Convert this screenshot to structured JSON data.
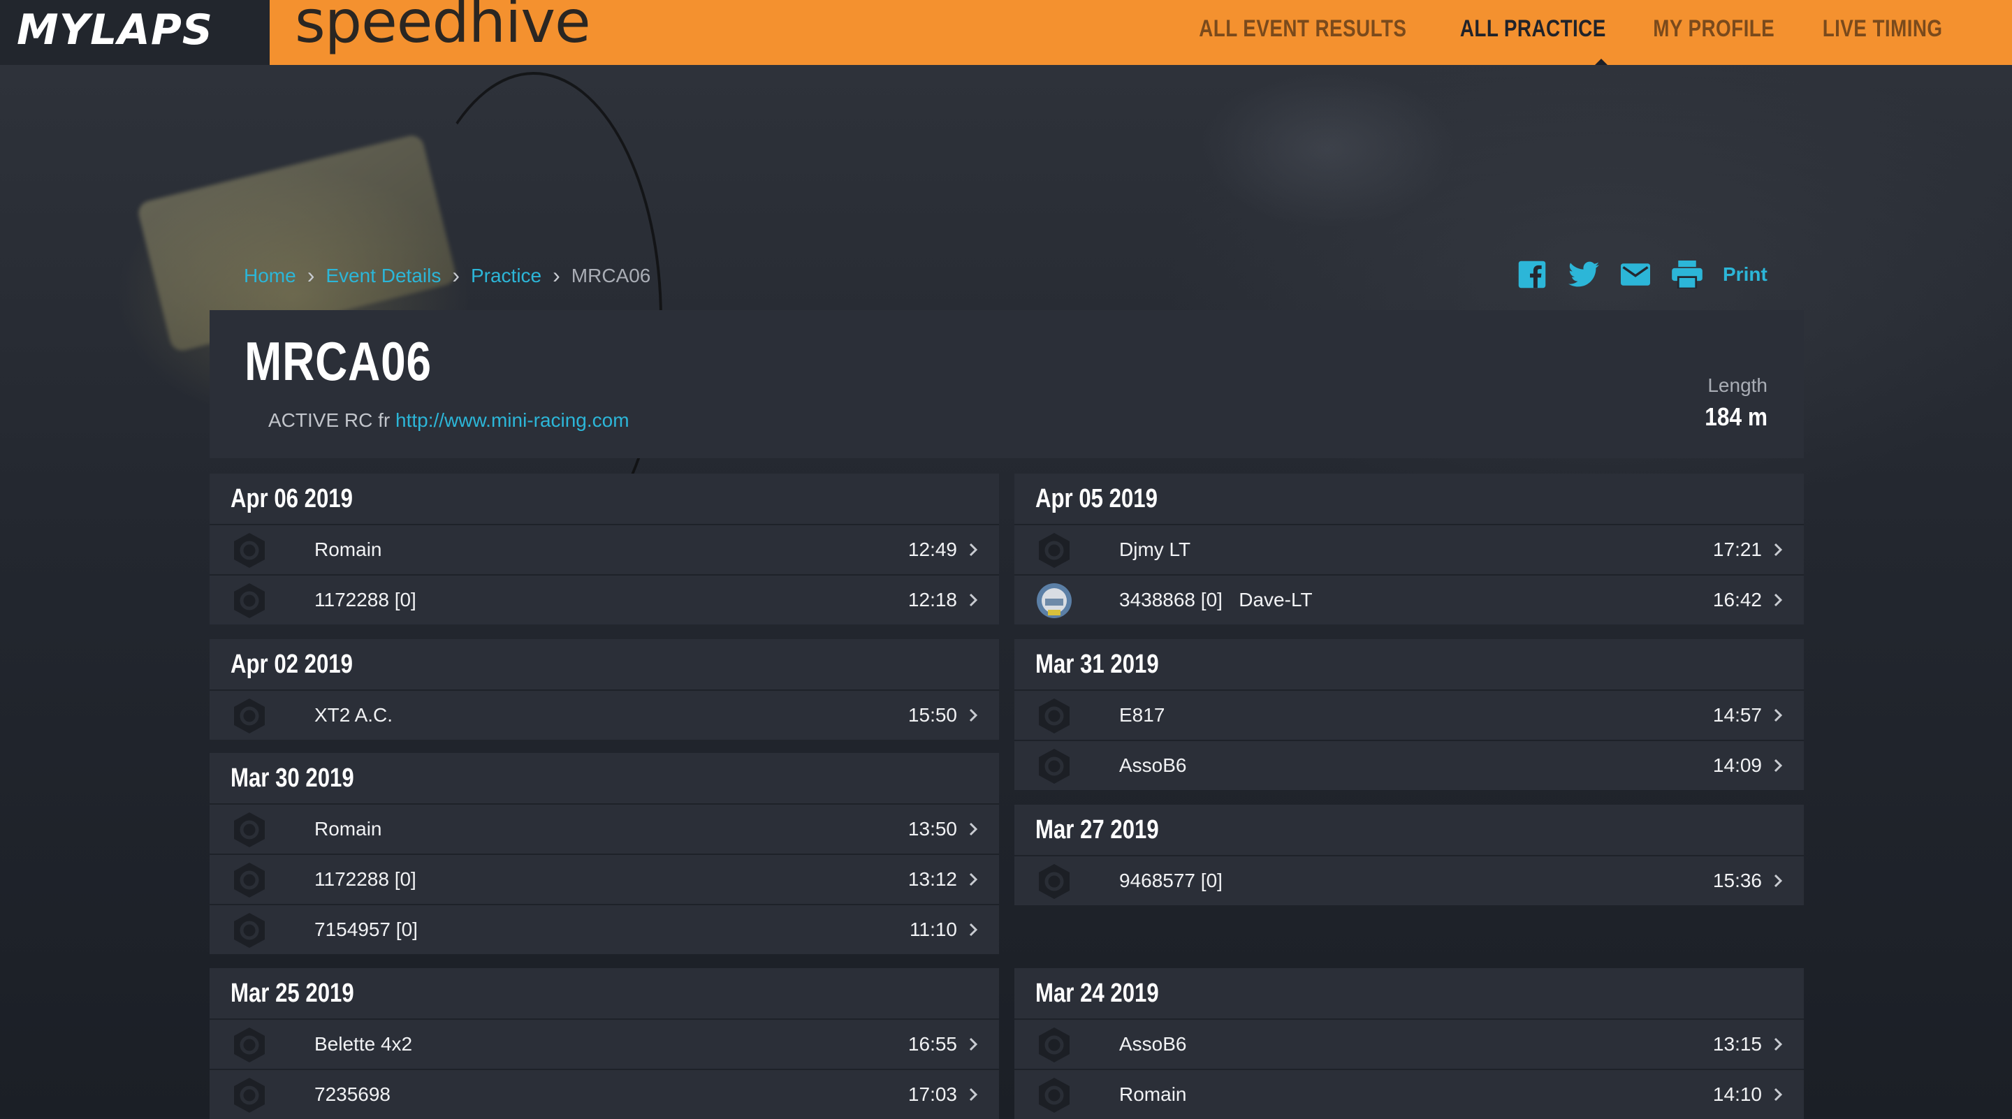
{
  "brand": {
    "mylaps": "MYLAPS",
    "speedhive": "speedhive"
  },
  "nav": [
    {
      "label": "ALL EVENT RESULTS",
      "active": false
    },
    {
      "label": "ALL PRACTICE",
      "active": true
    },
    {
      "label": "MY PROFILE",
      "active": false
    },
    {
      "label": "LIVE TIMING",
      "active": false
    }
  ],
  "breadcrumb": {
    "home": "Home",
    "event": "Event Details",
    "practice": "Practice",
    "current": "MRCA06"
  },
  "share": {
    "print": "Print"
  },
  "track": {
    "name": "MRCA06",
    "club": "ACTIVE RC fr",
    "url": "http://www.mini-racing.com",
    "length_label": "Length",
    "length_value": "184 m"
  },
  "days": [
    {
      "date": "Apr 06 2019",
      "rows": [
        {
          "name": "Romain",
          "time": "12:49"
        },
        {
          "name": "1172288 [0]",
          "time": "12:18"
        }
      ]
    },
    {
      "date": "Apr 05 2019",
      "rows": [
        {
          "name": "Djmy LT",
          "time": "17:21"
        },
        {
          "name": "3438868 [0]   Dave-LT",
          "time": "16:42",
          "avatar": "photo"
        }
      ]
    },
    {
      "date": "Apr 02 2019",
      "rows": [
        {
          "name": "XT2 A.C.",
          "time": "15:50"
        }
      ]
    },
    {
      "date": "Mar 31 2019",
      "rows": [
        {
          "name": "E817",
          "time": "14:57"
        },
        {
          "name": "AssoB6",
          "time": "14:09"
        }
      ]
    },
    {
      "date": "Mar 30 2019",
      "rows": [
        {
          "name": "Romain",
          "time": "13:50"
        },
        {
          "name": "1172288 [0]",
          "time": "13:12"
        },
        {
          "name": "7154957 [0]",
          "time": "11:10"
        }
      ]
    },
    {
      "date": "Mar 27 2019",
      "rows": [
        {
          "name": "9468577 [0]",
          "time": "15:36"
        }
      ]
    },
    {
      "date": "Mar 25 2019",
      "rows": [
        {
          "name": "Belette 4x2",
          "time": "16:55"
        },
        {
          "name": "7235698",
          "time": "17:03"
        }
      ]
    },
    {
      "date": "Mar 24 2019",
      "rows": [
        {
          "name": "AssoB6",
          "time": "13:15"
        },
        {
          "name": "Romain",
          "time": "14:10"
        }
      ]
    }
  ]
}
